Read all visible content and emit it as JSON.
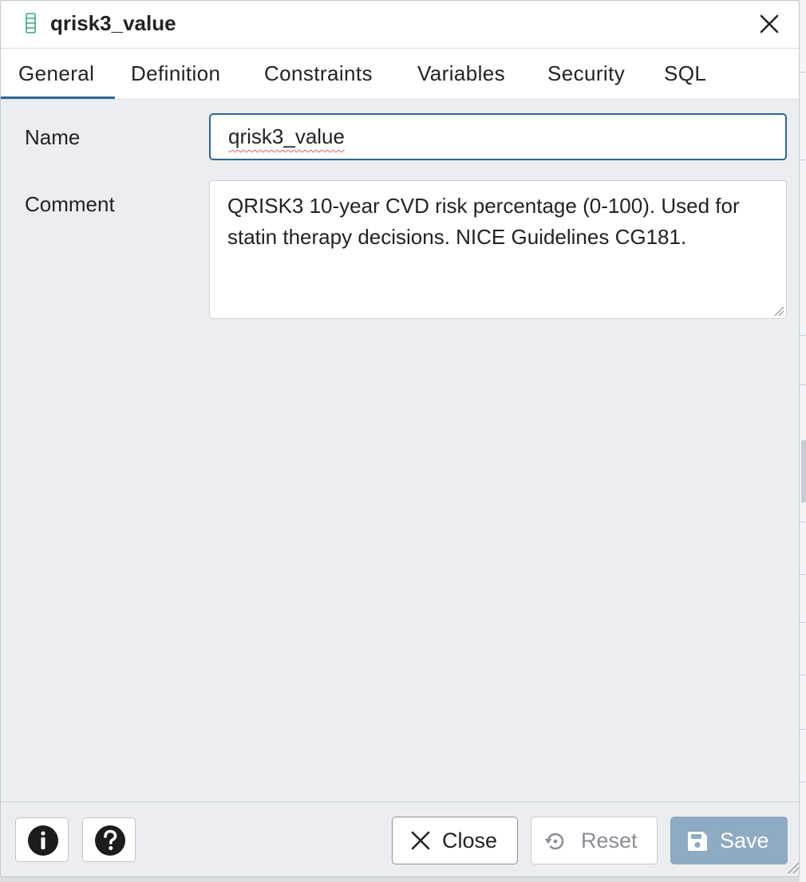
{
  "dialog": {
    "title": "qrisk3_value",
    "icon": "table-column-icon",
    "close_icon": "close-icon"
  },
  "tabs": [
    {
      "label": "General",
      "active": true
    },
    {
      "label": "Definition",
      "active": false
    },
    {
      "label": "Constraints",
      "active": false
    },
    {
      "label": "Variables",
      "active": false
    },
    {
      "label": "Security",
      "active": false
    },
    {
      "label": "SQL",
      "active": false
    }
  ],
  "form": {
    "name_label": "Name",
    "name_value": "qrisk3_value",
    "comment_label": "Comment",
    "comment_value": "QRISK3 10-year CVD risk percentage (0-100). Used for statin therapy decisions. NICE Guidelines CG181."
  },
  "footer": {
    "info_icon": "info-icon",
    "help_icon": "help-icon",
    "close_label": "Close",
    "reset_label": "Reset",
    "save_label": "Save"
  },
  "colors": {
    "accent": "#326690",
    "save_disabled": "#8faac3",
    "icon_green": "#3aa57a"
  }
}
